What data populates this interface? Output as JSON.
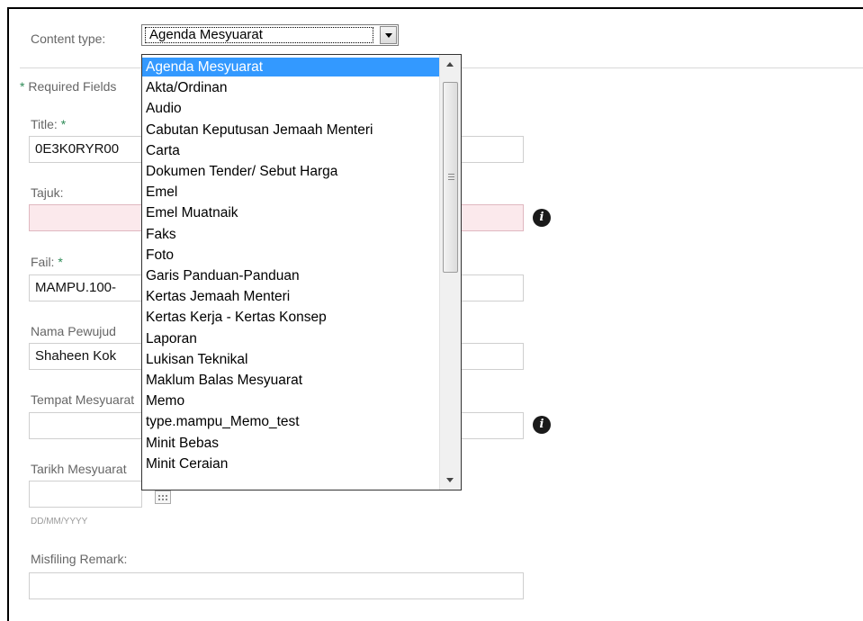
{
  "content_type": {
    "label": "Content type:",
    "selected": "Agenda Mesyuarat",
    "options": [
      "Agenda Mesyuarat",
      "Akta/Ordinan",
      "Audio",
      "Cabutan Keputusan Jemaah Menteri",
      "Carta",
      "Dokumen Tender/ Sebut Harga",
      "Emel",
      "Emel Muatnaik",
      "Faks",
      "Foto",
      "Garis Panduan-Panduan",
      "Kertas Jemaah Menteri",
      "Kertas Kerja - Kertas Konsep",
      "Laporan",
      "Lukisan Teknikal",
      "Maklum Balas Mesyuarat",
      "Memo",
      "type.mampu_Memo_test",
      "Minit Bebas",
      "Minit Ceraian"
    ]
  },
  "form": {
    "required_note_star": "*",
    "required_note": "Required Fields",
    "title_label": "Title:",
    "title_value": "0E3K0RYR00",
    "tajuk_label": "Tajuk:",
    "tajuk_value": "",
    "fail_label": "Fail:",
    "fail_value": "MAMPU.100-",
    "nama_label": "Nama Pewujud",
    "nama_value": "Shaheen Kok",
    "tempat_label": "Tempat Mesyuarat",
    "tempat_value": "",
    "tarikh_label": "Tarikh Mesyuarat",
    "tarikh_value": "",
    "tarikh_hint": "DD/MM/YYYY",
    "remark_label": "Misfiling Remark:",
    "remark_value": "",
    "required_star": "*",
    "info_glyph": "i"
  },
  "colors": {
    "selection": "#3399ff",
    "required_star": "#2e8b57",
    "invalid_field": "#fbe9ec"
  }
}
